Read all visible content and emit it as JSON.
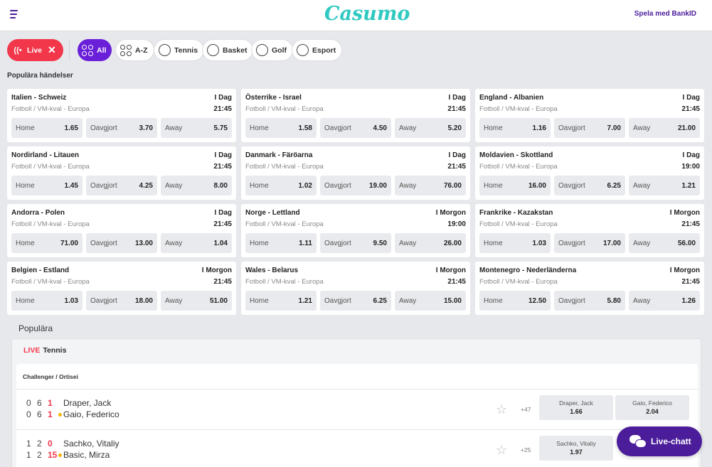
{
  "header": {
    "logo": "Casumo",
    "bankid_label": "Spela med BankID"
  },
  "filters": {
    "live": "Live",
    "all": "All",
    "az": "A-Z",
    "tennis": "Tennis",
    "basket": "Basket",
    "golf": "Golf",
    "esport": "Esport"
  },
  "popular_events_title": "Populära händelser",
  "events": [
    {
      "teams": "Italien - Schweiz",
      "day": "I Dag",
      "league": "Fotboll / VM-kval - Europa",
      "time": "21:45",
      "home": "1.65",
      "draw": "3.70",
      "away": "5.75"
    },
    {
      "teams": "Österrike - Israel",
      "day": "I Dag",
      "league": "Fotboll / VM-kval - Europa",
      "time": "21:45",
      "home": "1.58",
      "draw": "4.50",
      "away": "5.20"
    },
    {
      "teams": "England - Albanien",
      "day": "I Dag",
      "league": "Fotboll / VM-kval - Europa",
      "time": "21:45",
      "home": "1.16",
      "draw": "7.00",
      "away": "21.00"
    },
    {
      "teams": "Nordirland - Litauen",
      "day": "I Dag",
      "league": "Fotboll / VM-kval - Europa",
      "time": "21:45",
      "home": "1.45",
      "draw": "4.25",
      "away": "8.00"
    },
    {
      "teams": "Danmark - Färöarna",
      "day": "I Dag",
      "league": "Fotboll / VM-kval - Europa",
      "time": "21:45",
      "home": "1.02",
      "draw": "19.00",
      "away": "76.00"
    },
    {
      "teams": "Moldavien - Skottland",
      "day": "I Dag",
      "league": "Fotboll / VM-kval - Europa",
      "time": "19:00",
      "home": "16.00",
      "draw": "6.25",
      "away": "1.21"
    },
    {
      "teams": "Andorra - Polen",
      "day": "I Dag",
      "league": "Fotboll / VM-kval - Europa",
      "time": "21:45",
      "home": "71.00",
      "draw": "13.00",
      "away": "1.04"
    },
    {
      "teams": "Norge - Lettland",
      "day": "I Morgon",
      "league": "Fotboll / VM-kval - Europa",
      "time": "19:00",
      "home": "1.11",
      "draw": "9.50",
      "away": "26.00"
    },
    {
      "teams": "Frankrike - Kazakstan",
      "day": "I Morgon",
      "league": "Fotboll / VM-kval - Europa",
      "time": "21:45",
      "home": "1.03",
      "draw": "17.00",
      "away": "56.00"
    },
    {
      "teams": "Belgien - Estland",
      "day": "I Morgon",
      "league": "Fotboll / VM-kval - Europa",
      "time": "21:45",
      "home": "1.03",
      "draw": "18.00",
      "away": "51.00"
    },
    {
      "teams": "Wales - Belarus",
      "day": "I Morgon",
      "league": "Fotboll / VM-kval - Europa",
      "time": "21:45",
      "home": "1.21",
      "draw": "6.25",
      "away": "15.00"
    },
    {
      "teams": "Montenegro - Nederländerna",
      "day": "I Morgon",
      "league": "Fotboll / VM-kval - Europa",
      "time": "21:45",
      "home": "12.50",
      "draw": "5.80",
      "away": "1.26"
    }
  ],
  "odds_labels": {
    "home": "Home",
    "draw": "Oavgjort",
    "away": "Away"
  },
  "popular": {
    "title": "Populära",
    "live_word": "LIVE",
    "sport": "Tennis",
    "league": "Challenger / Ortisei",
    "matches": [
      {
        "p1": {
          "name": "Draper, Jack",
          "s1": "0",
          "s2": "6",
          "s3": "1"
        },
        "p2": {
          "name": "Gaio, Federico",
          "s1": "0",
          "s2": "6",
          "s3": "1"
        },
        "more": "+47",
        "odd1": {
          "name": "Draper, Jack",
          "value": "1.66"
        },
        "odd2": {
          "name": "Gaio, Federico",
          "value": "2.04"
        }
      },
      {
        "p1": {
          "name": "Sachko, Vitaliy",
          "s1": "1",
          "s2": "2",
          "s3": "0"
        },
        "p2": {
          "name": "Basic, Mirza",
          "s1": "1",
          "s2": "2",
          "s3": "15"
        },
        "more": "+25",
        "odd1": {
          "name": "Sachko, Vitaliy",
          "value": "1.97"
        },
        "odd2": {
          "name": "",
          "value": ""
        }
      }
    ]
  },
  "chat_label": "Live-chatt"
}
